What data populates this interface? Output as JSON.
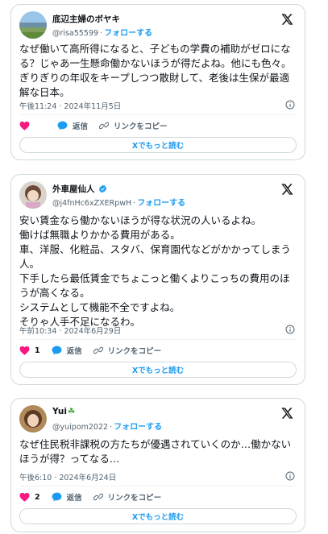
{
  "tweets": [
    {
      "name": "底辺主婦のボヤキ",
      "handle": "@risa55599",
      "follow": "フォローする",
      "verified": false,
      "text": "なぜ働いて高所得になると、子どもの学費の補助がゼロになる？じゃあ一生懸命働かないほうが得だよね。他にも色々。ぎりぎりの年収をキープしつつ散財して、老後は生保が最適解な日本。",
      "timestamp": "午後11:24 · 2024年11月5日",
      "likes": "",
      "reply_label": "返信",
      "copy_label": "リンクをコピー",
      "readmore": "Xでもっと読む"
    },
    {
      "name": "外車屋仙人",
      "handle": "@j4fnHc6xZXERpwH",
      "follow": "フォローする",
      "verified": true,
      "text": "安い賃金なら働かないほうが得な状況の人いるよね。\n働けば無職よりかかる費用がある。\n車、洋服、化粧品、スタバ、保育園代などがかかってしまう人。\n下手したら最低賃金でちょこっと働くよりこっちの費用のほうが高くなる。\nシステムとして機能不全ですよね。\nそりゃ人手不足になるわ。",
      "timestamp": "午前10:34 · 2024年6月29日",
      "likes": "1",
      "reply_label": "返信",
      "copy_label": "リンクをコピー",
      "readmore": "Xでもっと読む"
    },
    {
      "name": "Yui",
      "name_emoji": "☘",
      "handle": "@yuipom2022",
      "follow": "フォローする",
      "verified": false,
      "text": "なぜ住民税非課税の方たちが優遇されていくのか…働かないほうが得？ってなる…",
      "timestamp": "午後6:10 · 2024年6月24日",
      "likes": "2",
      "reply_label": "返信",
      "copy_label": "リンクをコピー",
      "readmore": "Xでもっと読む"
    }
  ],
  "colors": {
    "heart": "#f91880",
    "accent": "#1d9bf0",
    "muted": "#536471",
    "border": "#cfd9de"
  }
}
